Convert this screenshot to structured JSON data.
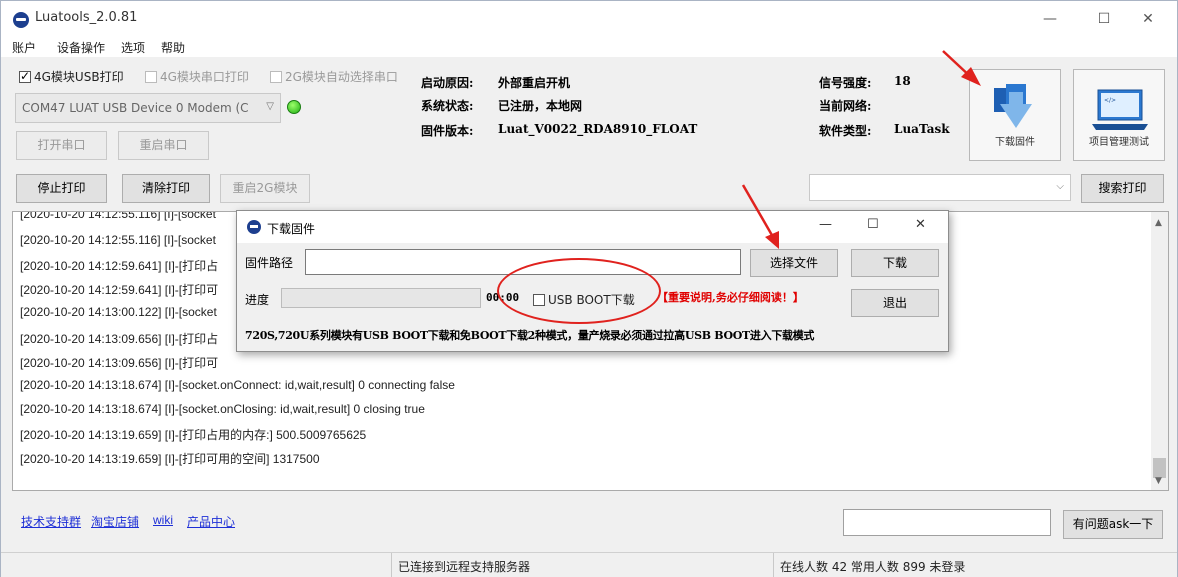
{
  "window": {
    "title": "Luatools_2.0.81",
    "minimize": "—",
    "maximize": "☐",
    "close": "✕"
  },
  "menu": [
    "账户",
    "设备操作",
    "选项",
    "帮助"
  ],
  "options": {
    "usb_print": "4G模块USB打印",
    "serial_print": "4G模块串口打印",
    "auto_select": "2G模块自动选择串口"
  },
  "port": {
    "selected": "COM47 LUAT USB Device 0 Modem (C",
    "open_btn": "打开串口",
    "restart_btn": "重启串口"
  },
  "info": {
    "boot_reason_label": "启动原因:",
    "boot_reason": "外部重启开机",
    "sys_state_label": "系统状态:",
    "sys_state": "已注册，本地网",
    "fw_version_label": "固件版本:",
    "fw_version": "Luat_V0022_RDA8910_FLOAT",
    "signal_label": "信号强度:",
    "signal": "18",
    "network_label": "当前网络:",
    "network": "",
    "sw_type_label": "软件类型:",
    "sw_type": "LuaTask"
  },
  "tiles": {
    "download": "下载固件",
    "project": "项目管理测试"
  },
  "toolbar": {
    "stop": "停止打印",
    "clear": "清除打印",
    "restart2g": "重启2G模块",
    "search_value": "",
    "search_btn": "搜索打印"
  },
  "log": [
    "[2020-10-20 14:12:55.116] [I]-[socket",
    "[2020-10-20 14:12:55.116] [I]-[socket",
    "[2020-10-20 14:12:59.641] [I]-[打印占",
    "[2020-10-20 14:12:59.641] [I]-[打印可",
    "[2020-10-20 14:13:00.122] [I]-[socket",
    "[2020-10-20 14:13:09.656] [I]-[打印占",
    "[2020-10-20 14:13:09.656] [I]-[打印可",
    "[2020-10-20 14:13:18.674] [I]-[socket.onConnect: id,wait,result] 0 connecting false",
    "[2020-10-20 14:13:18.674] [I]-[socket.onClosing: id,wait,result] 0 closing true",
    "[2020-10-20 14:13:19.659] [I]-[打印占用的内存:] 500.5009765625",
    "[2020-10-20 14:13:19.659] [I]-[打印可用的空间] 1317500"
  ],
  "links": {
    "support": "技术支持群",
    "shop": "淘宝店铺",
    "wiki": "wiki",
    "products": "产品中心"
  },
  "ask": {
    "value": "",
    "button": "有问题ask一下"
  },
  "status": {
    "seg1": "",
    "seg2": "已连接到远程支持服务器",
    "seg3": "在线人数 42 常用人数 899 未登录"
  },
  "dialog": {
    "title": "下载固件",
    "path_label": "固件路径",
    "path_value": "",
    "choose_btn": "选择文件",
    "download_btn": "下载",
    "progress_label": "进度",
    "progress": 0,
    "time": "00:00",
    "usb_boot": "USB BOOT下载",
    "notice": "【重要说明,务必仔细阅读！】",
    "exit_btn": "退出",
    "description": "720S,720U系列模块有USB BOOT下载和免BOOT下载2种模式，量产烧录必须通过拉高USB BOOT进入下载模式"
  },
  "colors": {
    "annotation_red": "#e0221e",
    "link_blue": "#1e2fd6",
    "notice_red": "#e00000"
  }
}
